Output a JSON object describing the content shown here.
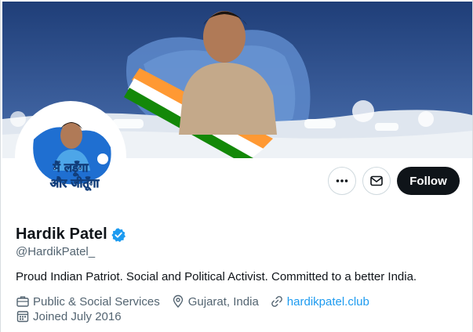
{
  "profile": {
    "name": "Hardik Patel",
    "handle": "@HardikPatel_",
    "bio": "Proud Indian Patriot. Social and Political Activist. Committed to a better India.",
    "category": "Public & Social Services",
    "location": "Gujarat, India",
    "website": "hardikpatel.club",
    "joined": "Joined July 2016",
    "verified": true
  },
  "actions": {
    "follow_label": "Follow"
  },
  "icons": {
    "more": "more-horizontal-icon",
    "message": "envelope-icon",
    "verified": "verified-badge-icon",
    "category": "briefcase-icon",
    "location": "location-pin-icon",
    "website": "link-icon",
    "joined": "calendar-icon"
  },
  "avatar_text": {
    "line1": "मैं लड़ूँगा",
    "line2": "और जीतूँगा"
  },
  "colors": {
    "follow_bg": "#0f1419",
    "link": "#1d9bf0",
    "verified": "#1d9bf0",
    "muted": "#536471"
  }
}
